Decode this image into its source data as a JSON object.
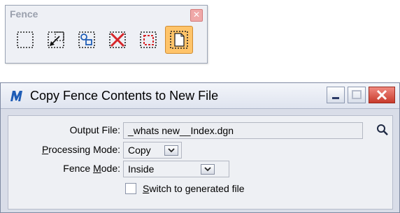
{
  "fence_toolbox": {
    "title": "Fence",
    "tools": [
      {
        "icon": "place-fence-block-icon"
      },
      {
        "icon": "modify-fence-icon"
      },
      {
        "icon": "manipulate-fence-contents-icon"
      },
      {
        "icon": "delete-fence-contents-icon"
      },
      {
        "icon": "drop-fence-icon"
      },
      {
        "icon": "file-fence-icon",
        "active": true
      }
    ]
  },
  "dialog": {
    "title": "Copy Fence Contents to New File",
    "output_file": {
      "label": "Output File:",
      "value": "_whats new__Index.dgn"
    },
    "processing_mode": {
      "label": "Processing Mode:",
      "value": "Copy"
    },
    "fence_mode": {
      "label": "Fence Mode:",
      "value": "Inside"
    },
    "switch_checkbox": {
      "label": "Switch to generated file",
      "checked": false
    }
  },
  "colors": {
    "active_tool_bg": "#ffc46a",
    "close_button": "#c83b2c",
    "delete_icon": "#d6262a",
    "icon_blue": "#1f5db6"
  }
}
